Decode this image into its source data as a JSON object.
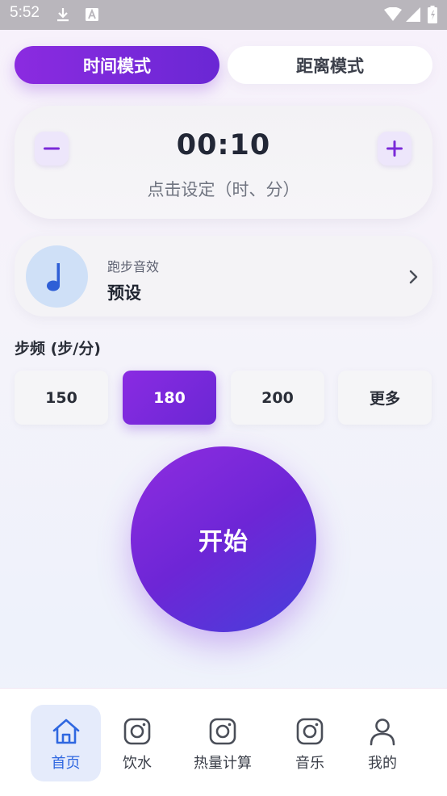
{
  "status_bar": {
    "time": "5:52"
  },
  "mode_tabs": [
    {
      "label": "时间模式",
      "active": true
    },
    {
      "label": "距离模式",
      "active": false
    }
  ],
  "timer": {
    "value": "00:10",
    "hint": "点击设定（时、分）",
    "minus_icon": "minus-icon",
    "plus_icon": "plus-icon"
  },
  "sound": {
    "label": "跑步音效",
    "value": "预设",
    "icon": "music-note-icon"
  },
  "cadence": {
    "label": "步频 (步/分)",
    "options": [
      "150",
      "180",
      "200",
      "更多"
    ],
    "selected": "180"
  },
  "start": {
    "label": "开始"
  },
  "bottom_nav": [
    {
      "label": "首页",
      "icon": "home-icon",
      "active": true
    },
    {
      "label": "饮水",
      "icon": "instagram-icon",
      "active": false
    },
    {
      "label": "热量计算",
      "icon": "instagram-icon",
      "active": false
    },
    {
      "label": "音乐",
      "icon": "instagram-icon",
      "active": false
    },
    {
      "label": "我的",
      "icon": "person-icon",
      "active": false
    }
  ],
  "colors": {
    "accent_purple": "#7a2ad8",
    "nav_active_blue": "#2f67e0",
    "start_gradient_end": "#4640db"
  }
}
